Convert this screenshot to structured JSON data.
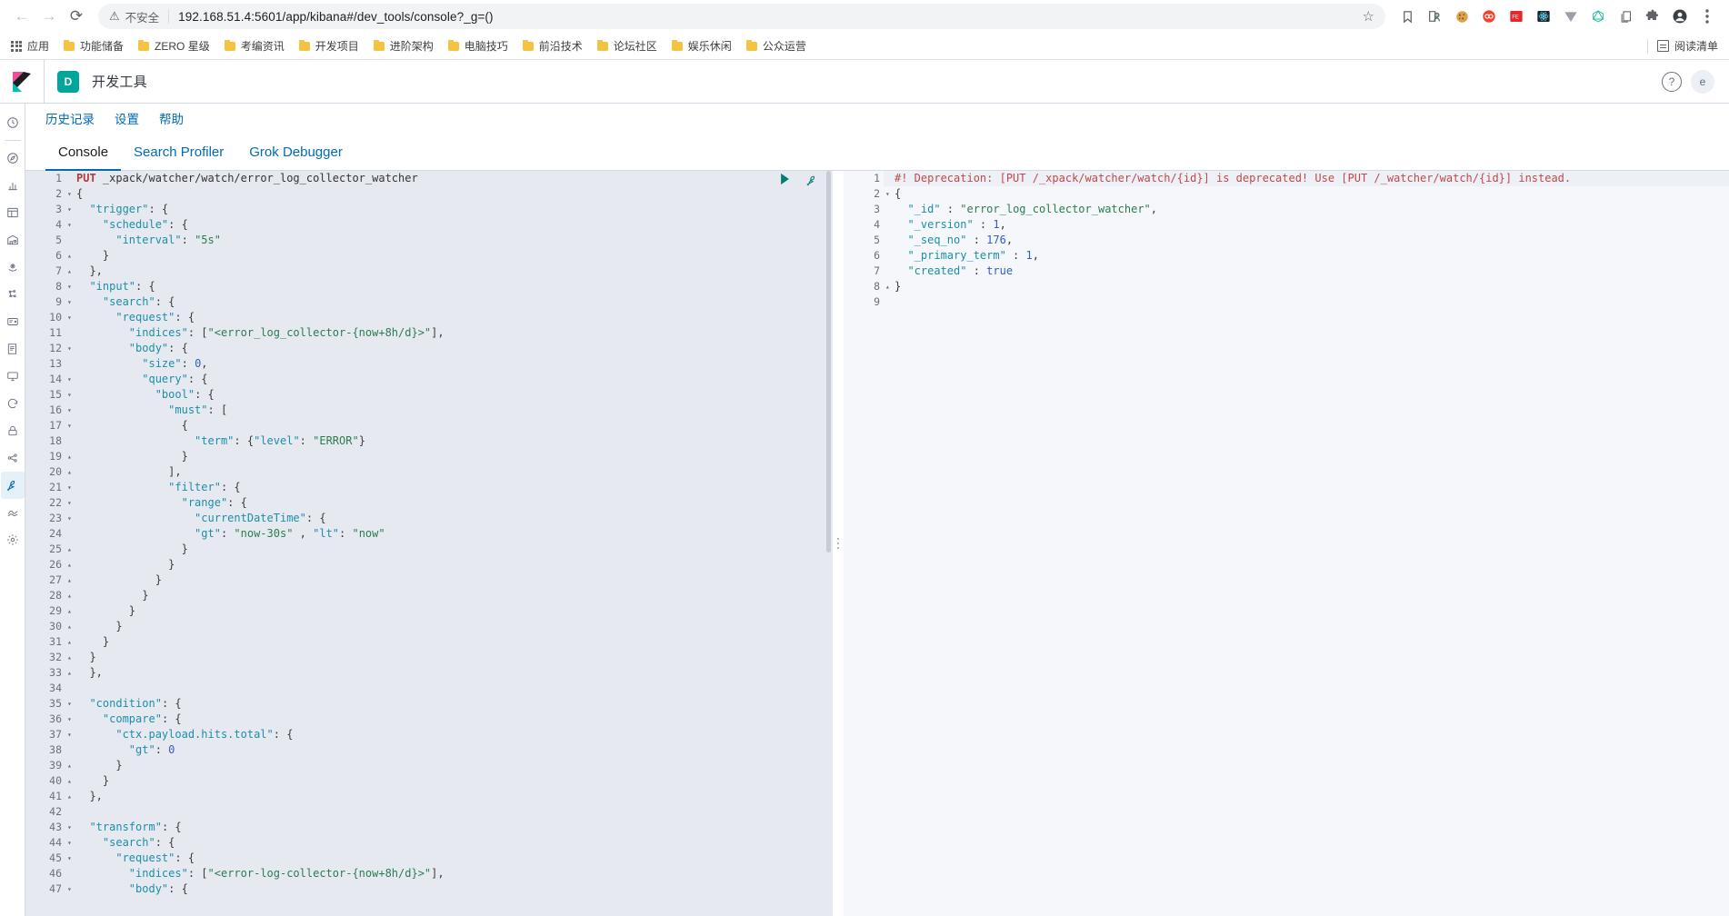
{
  "browser": {
    "nav": {
      "back": "←",
      "forward": "→",
      "reload": "⟳"
    },
    "security_label": "不安全",
    "url": "192.168.51.4:5601/app/kibana#/dev_tools/console?_g=()",
    "star_icon": "☆",
    "toolbar_icons": [
      "bookmark-icon",
      "profile-badge-icon",
      "cookie-icon",
      "infinity-icon",
      "feedly-icon",
      "react-devtools-icon",
      "vue-devtools-icon",
      "graphql-icon",
      "copy-icon",
      "extensions-icon",
      "account-icon",
      "menu-icon"
    ],
    "bookmarks": {
      "apps_label": "应用",
      "items": [
        "功能储备",
        "ZERO 星级",
        "考编资讯",
        "开发项目",
        "进阶架构",
        "电脑技巧",
        "前沿技术",
        "论坛社区",
        "娱乐休闲",
        "公众运营"
      ],
      "reading_list_label": "阅读清单"
    }
  },
  "kibana": {
    "app_badge": "D",
    "app_title": "开发工具",
    "help_icon": "?",
    "avatar_initial": "e",
    "subnav": [
      "历史记录",
      "设置",
      "帮助"
    ],
    "tabs": [
      {
        "label": "Console",
        "active": true
      },
      {
        "label": "Search Profiler",
        "active": false
      },
      {
        "label": "Grok Debugger",
        "active": false
      }
    ],
    "nav_icons": [
      "recently-viewed-icon",
      "discover-compass-icon",
      "visualize-chart-icon",
      "dashboard-icon",
      "canvas-icon",
      "maps-icon",
      "machine-learning-icon",
      "infrastructure-icon",
      "logs-icon",
      "apm-icon",
      "uptime-icon",
      "siem-lock-icon",
      "graph-icon",
      "dev-tools-wrench-icon",
      "monitoring-icon",
      "management-gear-icon"
    ],
    "editor_actions": {
      "play": "send-request-play-icon",
      "wrench": "open-docs-wrench-icon"
    }
  },
  "request_editor": {
    "lines": [
      {
        "n": 1,
        "fold": "",
        "tokens": [
          {
            "t": "method",
            "v": "PUT"
          },
          {
            "t": "plain",
            "v": " "
          },
          {
            "t": "url",
            "v": "_xpack/watcher/watch/error_log_collector_watcher"
          }
        ]
      },
      {
        "n": 2,
        "fold": "▾",
        "tokens": [
          {
            "t": "punct",
            "v": "{"
          }
        ]
      },
      {
        "n": 3,
        "fold": "▾",
        "tokens": [
          {
            "t": "plain",
            "v": "  "
          },
          {
            "t": "key",
            "v": "\"trigger\""
          },
          {
            "t": "punct",
            "v": ": {"
          }
        ]
      },
      {
        "n": 4,
        "fold": "▾",
        "tokens": [
          {
            "t": "plain",
            "v": "    "
          },
          {
            "t": "key",
            "v": "\"schedule\""
          },
          {
            "t": "punct",
            "v": ": {"
          }
        ]
      },
      {
        "n": 5,
        "fold": "",
        "tokens": [
          {
            "t": "plain",
            "v": "      "
          },
          {
            "t": "key",
            "v": "\"interval\""
          },
          {
            "t": "punct",
            "v": ": "
          },
          {
            "t": "str",
            "v": "\"5s\""
          }
        ]
      },
      {
        "n": 6,
        "fold": "▴",
        "tokens": [
          {
            "t": "plain",
            "v": "    "
          },
          {
            "t": "punct",
            "v": "}"
          }
        ]
      },
      {
        "n": 7,
        "fold": "▴",
        "tokens": [
          {
            "t": "plain",
            "v": "  "
          },
          {
            "t": "punct",
            "v": "},"
          }
        ]
      },
      {
        "n": 8,
        "fold": "▾",
        "tokens": [
          {
            "t": "plain",
            "v": "  "
          },
          {
            "t": "key",
            "v": "\"input\""
          },
          {
            "t": "punct",
            "v": ": {"
          }
        ]
      },
      {
        "n": 9,
        "fold": "▾",
        "tokens": [
          {
            "t": "plain",
            "v": "    "
          },
          {
            "t": "key",
            "v": "\"search\""
          },
          {
            "t": "punct",
            "v": ": {"
          }
        ]
      },
      {
        "n": 10,
        "fold": "▾",
        "tokens": [
          {
            "t": "plain",
            "v": "      "
          },
          {
            "t": "key",
            "v": "\"request\""
          },
          {
            "t": "punct",
            "v": ": {"
          }
        ]
      },
      {
        "n": 11,
        "fold": "",
        "tokens": [
          {
            "t": "plain",
            "v": "        "
          },
          {
            "t": "key",
            "v": "\"indices\""
          },
          {
            "t": "punct",
            "v": ": ["
          },
          {
            "t": "str",
            "v": "\"<error_log_collector-{now+8h/d}>\""
          },
          {
            "t": "punct",
            "v": "],"
          }
        ]
      },
      {
        "n": 12,
        "fold": "▾",
        "tokens": [
          {
            "t": "plain",
            "v": "        "
          },
          {
            "t": "key",
            "v": "\"body\""
          },
          {
            "t": "punct",
            "v": ": {"
          }
        ]
      },
      {
        "n": 13,
        "fold": "",
        "tokens": [
          {
            "t": "plain",
            "v": "          "
          },
          {
            "t": "key",
            "v": "\"size\""
          },
          {
            "t": "punct",
            "v": ": "
          },
          {
            "t": "num",
            "v": "0"
          },
          {
            "t": "punct",
            "v": ","
          }
        ]
      },
      {
        "n": 14,
        "fold": "▾",
        "tokens": [
          {
            "t": "plain",
            "v": "          "
          },
          {
            "t": "key",
            "v": "\"query\""
          },
          {
            "t": "punct",
            "v": ": {"
          }
        ]
      },
      {
        "n": 15,
        "fold": "▾",
        "tokens": [
          {
            "t": "plain",
            "v": "            "
          },
          {
            "t": "key",
            "v": "\"bool\""
          },
          {
            "t": "punct",
            "v": ": {"
          }
        ]
      },
      {
        "n": 16,
        "fold": "▾",
        "tokens": [
          {
            "t": "plain",
            "v": "              "
          },
          {
            "t": "key",
            "v": "\"must\""
          },
          {
            "t": "punct",
            "v": ": ["
          }
        ]
      },
      {
        "n": 17,
        "fold": "▾",
        "tokens": [
          {
            "t": "plain",
            "v": "                "
          },
          {
            "t": "punct",
            "v": "{"
          }
        ]
      },
      {
        "n": 18,
        "fold": "",
        "tokens": [
          {
            "t": "plain",
            "v": "                  "
          },
          {
            "t": "key",
            "v": "\"term\""
          },
          {
            "t": "punct",
            "v": ": {"
          },
          {
            "t": "key",
            "v": "\"level\""
          },
          {
            "t": "punct",
            "v": ": "
          },
          {
            "t": "str",
            "v": "\"ERROR\""
          },
          {
            "t": "punct",
            "v": "}"
          }
        ]
      },
      {
        "n": 19,
        "fold": "▴",
        "tokens": [
          {
            "t": "plain",
            "v": "                "
          },
          {
            "t": "punct",
            "v": "}"
          }
        ]
      },
      {
        "n": 20,
        "fold": "▴",
        "tokens": [
          {
            "t": "plain",
            "v": "              "
          },
          {
            "t": "punct",
            "v": "],"
          }
        ]
      },
      {
        "n": 21,
        "fold": "▾",
        "tokens": [
          {
            "t": "plain",
            "v": "              "
          },
          {
            "t": "key",
            "v": "\"filter\""
          },
          {
            "t": "punct",
            "v": ": {"
          }
        ]
      },
      {
        "n": 22,
        "fold": "▾",
        "tokens": [
          {
            "t": "plain",
            "v": "                "
          },
          {
            "t": "key",
            "v": "\"range\""
          },
          {
            "t": "punct",
            "v": ": {"
          }
        ]
      },
      {
        "n": 23,
        "fold": "▾",
        "tokens": [
          {
            "t": "plain",
            "v": "                  "
          },
          {
            "t": "key",
            "v": "\"currentDateTime\""
          },
          {
            "t": "punct",
            "v": ": {"
          }
        ]
      },
      {
        "n": 24,
        "fold": "",
        "tokens": [
          {
            "t": "plain",
            "v": "                  "
          },
          {
            "t": "key",
            "v": "\"gt\""
          },
          {
            "t": "punct",
            "v": ": "
          },
          {
            "t": "str",
            "v": "\"now-30s\""
          },
          {
            "t": "punct",
            "v": " , "
          },
          {
            "t": "key",
            "v": "\"lt\""
          },
          {
            "t": "punct",
            "v": ": "
          },
          {
            "t": "str",
            "v": "\"now\""
          }
        ]
      },
      {
        "n": 25,
        "fold": "▴",
        "tokens": [
          {
            "t": "plain",
            "v": "                "
          },
          {
            "t": "punct",
            "v": "}"
          }
        ]
      },
      {
        "n": 26,
        "fold": "▴",
        "tokens": [
          {
            "t": "plain",
            "v": "              "
          },
          {
            "t": "punct",
            "v": "}"
          }
        ]
      },
      {
        "n": 27,
        "fold": "▴",
        "tokens": [
          {
            "t": "plain",
            "v": "            "
          },
          {
            "t": "punct",
            "v": "}"
          }
        ]
      },
      {
        "n": 28,
        "fold": "▴",
        "tokens": [
          {
            "t": "plain",
            "v": "          "
          },
          {
            "t": "punct",
            "v": "}"
          }
        ]
      },
      {
        "n": 29,
        "fold": "▴",
        "tokens": [
          {
            "t": "plain",
            "v": "        "
          },
          {
            "t": "punct",
            "v": "}"
          }
        ]
      },
      {
        "n": 30,
        "fold": "▴",
        "tokens": [
          {
            "t": "plain",
            "v": "      "
          },
          {
            "t": "punct",
            "v": "}"
          }
        ]
      },
      {
        "n": 31,
        "fold": "▴",
        "tokens": [
          {
            "t": "plain",
            "v": "    "
          },
          {
            "t": "punct",
            "v": "}"
          }
        ]
      },
      {
        "n": 32,
        "fold": "▴",
        "tokens": [
          {
            "t": "plain",
            "v": "  "
          },
          {
            "t": "punct",
            "v": "}"
          }
        ]
      },
      {
        "n": 33,
        "fold": "▴",
        "tokens": [
          {
            "t": "plain",
            "v": "  "
          },
          {
            "t": "punct",
            "v": "},"
          }
        ]
      },
      {
        "n": 34,
        "fold": "",
        "tokens": []
      },
      {
        "n": 35,
        "fold": "▾",
        "tokens": [
          {
            "t": "plain",
            "v": "  "
          },
          {
            "t": "key",
            "v": "\"condition\""
          },
          {
            "t": "punct",
            "v": ": {"
          }
        ]
      },
      {
        "n": 36,
        "fold": "▾",
        "tokens": [
          {
            "t": "plain",
            "v": "    "
          },
          {
            "t": "key",
            "v": "\"compare\""
          },
          {
            "t": "punct",
            "v": ": {"
          }
        ]
      },
      {
        "n": 37,
        "fold": "▾",
        "tokens": [
          {
            "t": "plain",
            "v": "      "
          },
          {
            "t": "key",
            "v": "\"ctx.payload.hits.total\""
          },
          {
            "t": "punct",
            "v": ": {"
          }
        ]
      },
      {
        "n": 38,
        "fold": "",
        "tokens": [
          {
            "t": "plain",
            "v": "        "
          },
          {
            "t": "key",
            "v": "\"gt\""
          },
          {
            "t": "punct",
            "v": ": "
          },
          {
            "t": "num",
            "v": "0"
          }
        ]
      },
      {
        "n": 39,
        "fold": "▴",
        "tokens": [
          {
            "t": "plain",
            "v": "      "
          },
          {
            "t": "punct",
            "v": "}"
          }
        ]
      },
      {
        "n": 40,
        "fold": "▴",
        "tokens": [
          {
            "t": "plain",
            "v": "    "
          },
          {
            "t": "punct",
            "v": "}"
          }
        ]
      },
      {
        "n": 41,
        "fold": "▴",
        "tokens": [
          {
            "t": "plain",
            "v": "  "
          },
          {
            "t": "punct",
            "v": "},"
          }
        ]
      },
      {
        "n": 42,
        "fold": "",
        "tokens": []
      },
      {
        "n": 43,
        "fold": "▾",
        "tokens": [
          {
            "t": "plain",
            "v": "  "
          },
          {
            "t": "key",
            "v": "\"transform\""
          },
          {
            "t": "punct",
            "v": ": {"
          }
        ]
      },
      {
        "n": 44,
        "fold": "▾",
        "tokens": [
          {
            "t": "plain",
            "v": "    "
          },
          {
            "t": "key",
            "v": "\"search\""
          },
          {
            "t": "punct",
            "v": ": {"
          }
        ]
      },
      {
        "n": 45,
        "fold": "▾",
        "tokens": [
          {
            "t": "plain",
            "v": "      "
          },
          {
            "t": "key",
            "v": "\"request\""
          },
          {
            "t": "punct",
            "v": ": {"
          }
        ]
      },
      {
        "n": 46,
        "fold": "",
        "tokens": [
          {
            "t": "plain",
            "v": "        "
          },
          {
            "t": "key",
            "v": "\"indices\""
          },
          {
            "t": "punct",
            "v": ": ["
          },
          {
            "t": "str",
            "v": "\"<error-log-collector-{now+8h/d}>\""
          },
          {
            "t": "punct",
            "v": "],"
          }
        ]
      },
      {
        "n": 47,
        "fold": "▾",
        "tokens": [
          {
            "t": "plain",
            "v": "        "
          },
          {
            "t": "key",
            "v": "\"body\""
          },
          {
            "t": "punct",
            "v": ": {"
          }
        ]
      }
    ]
  },
  "response_editor": {
    "lines": [
      {
        "n": 1,
        "fold": "",
        "highlight": true,
        "tokens": [
          {
            "t": "warn",
            "v": "#! Deprecation: [PUT /_xpack/watcher/watch/{id}] is deprecated! Use [PUT /_watcher/watch/{id}] instead."
          }
        ]
      },
      {
        "n": 2,
        "fold": "▾",
        "highlight": false,
        "tokens": [
          {
            "t": "punct",
            "v": "{"
          }
        ]
      },
      {
        "n": 3,
        "fold": "",
        "highlight": false,
        "tokens": [
          {
            "t": "plain",
            "v": "  "
          },
          {
            "t": "key",
            "v": "\"_id\""
          },
          {
            "t": "punct",
            "v": " : "
          },
          {
            "t": "str",
            "v": "\"error_log_collector_watcher\""
          },
          {
            "t": "punct",
            "v": ","
          }
        ]
      },
      {
        "n": 4,
        "fold": "",
        "highlight": false,
        "tokens": [
          {
            "t": "plain",
            "v": "  "
          },
          {
            "t": "key",
            "v": "\"_version\""
          },
          {
            "t": "punct",
            "v": " : "
          },
          {
            "t": "num",
            "v": "1"
          },
          {
            "t": "punct",
            "v": ","
          }
        ]
      },
      {
        "n": 5,
        "fold": "",
        "highlight": false,
        "tokens": [
          {
            "t": "plain",
            "v": "  "
          },
          {
            "t": "key",
            "v": "\"_seq_no\""
          },
          {
            "t": "punct",
            "v": " : "
          },
          {
            "t": "num",
            "v": "176"
          },
          {
            "t": "punct",
            "v": ","
          }
        ]
      },
      {
        "n": 6,
        "fold": "",
        "highlight": false,
        "tokens": [
          {
            "t": "plain",
            "v": "  "
          },
          {
            "t": "key",
            "v": "\"_primary_term\""
          },
          {
            "t": "punct",
            "v": " : "
          },
          {
            "t": "num",
            "v": "1"
          },
          {
            "t": "punct",
            "v": ","
          }
        ]
      },
      {
        "n": 7,
        "fold": "",
        "highlight": false,
        "tokens": [
          {
            "t": "plain",
            "v": "  "
          },
          {
            "t": "key",
            "v": "\"created\""
          },
          {
            "t": "punct",
            "v": " : "
          },
          {
            "t": "bool",
            "v": "true"
          }
        ]
      },
      {
        "n": 8,
        "fold": "▴",
        "highlight": false,
        "tokens": [
          {
            "t": "punct",
            "v": "}"
          }
        ]
      },
      {
        "n": 9,
        "fold": "",
        "highlight": false,
        "tokens": []
      }
    ]
  },
  "colors": {
    "kibana_accent": "#006bb4",
    "badge_teal": "#00a69b",
    "editor_bg": "#e7e9f1",
    "response_bg": "#f5f7fa",
    "deprecation_red": "#bd4a4a"
  }
}
